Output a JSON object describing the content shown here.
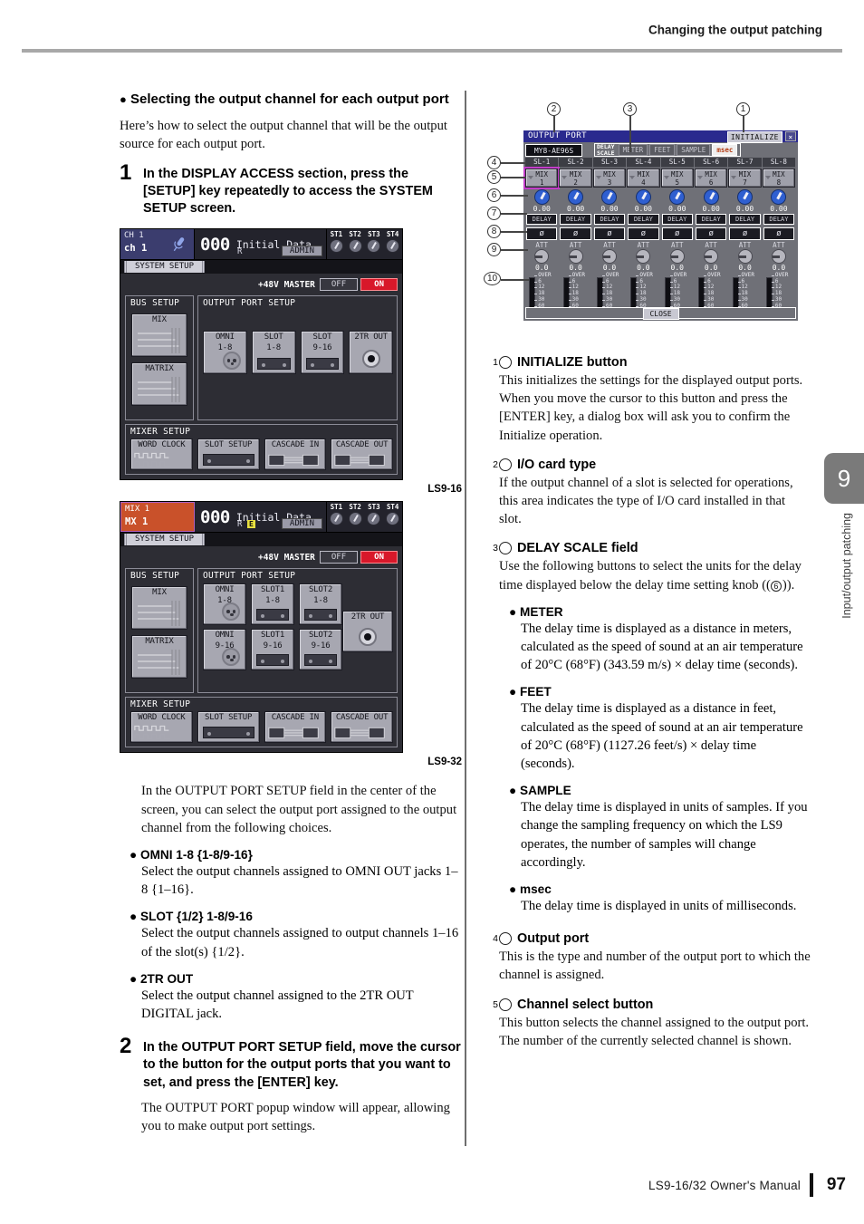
{
  "page": {
    "header_title": "Changing the output patching",
    "footer_manual": "LS9-16/32  Owner's Manual",
    "footer_page": "97",
    "side_tab_number": "9",
    "side_tab_label": "Input/output patching"
  },
  "left_column": {
    "section_heading": "Selecting the output channel for each output port",
    "intro": "Here’s how to select the output channel that will be the output source for each output port.",
    "step1": {
      "num": "1",
      "text": "In the DISPLAY ACCESS section, press the [SETUP] key repeatedly to access the SYSTEM SETUP screen."
    },
    "caption_ls9_16": "LS9-16",
    "caption_ls9_32": "LS9-32",
    "after_figures": "In the OUTPUT PORT SETUP field in the center of the screen, you can select the output port assigned to the output channel from the following choices.",
    "bullets": [
      {
        "head": "OMNI 1-8 {1-8/9-16}",
        "body": "Select the output channels assigned to OMNI OUT jacks 1–8 {1–16}."
      },
      {
        "head": "SLOT {1/2} 1-8/9-16",
        "body": "Select the output channels assigned to output channels 1–16 of the slot(s) {1/2}."
      },
      {
        "head": "2TR OUT",
        "body": "Select the output channel assigned to the 2TR OUT DIGITAL jack."
      }
    ],
    "step2": {
      "num": "2",
      "text": "In the OUTPUT PORT SETUP field, move the cursor to the button for the output ports that you want to set, and press the [ENTER] key."
    },
    "step2_body": "The OUTPUT PORT popup window will appear, allowing you to make output port settings."
  },
  "lcd_ls9_16": {
    "channel_label_top": "CH 1",
    "channel_label_bottom": "ch 1",
    "scene_number": "000",
    "scene_name": "Initial Data",
    "scene_r": "R",
    "user_level": "ADMIN",
    "st_labels": [
      "ST1",
      "ST2",
      "ST3",
      "ST4"
    ],
    "tab": "SYSTEM SETUP",
    "phantom_label": "+48V MASTER",
    "phantom_off": "OFF",
    "phantom_on": "ON",
    "bus_setup_title": "BUS SETUP",
    "bus_buttons": [
      "MIX",
      "MATRIX"
    ],
    "output_port_setup_title": "OUTPUT PORT SETUP",
    "output_buttons": [
      {
        "l1": "OMNI",
        "l2": "1-8",
        "icon": "xlr-icon"
      },
      {
        "l1": "SLOT",
        "l2": "1-8",
        "icon": "slot-icon"
      },
      {
        "l1": "SLOT",
        "l2": "9-16",
        "icon": "slot-icon"
      },
      {
        "l1": "2TR OUT",
        "l2": "",
        "icon": "coax-icon"
      }
    ],
    "mixer_setup_title": "MIXER SETUP",
    "mixer_buttons": [
      "WORD CLOCK",
      "SLOT SETUP",
      "CASCADE IN",
      "CASCADE OUT"
    ]
  },
  "lcd_ls9_32": {
    "channel_label_top": "MIX 1",
    "channel_label_bottom": "MX 1",
    "scene_number": "000",
    "scene_name": "Initial Data",
    "scene_r": "R",
    "scene_edit": "E",
    "user_level": "ADMIN",
    "st_labels": [
      "ST1",
      "ST2",
      "ST3",
      "ST4"
    ],
    "tab": "SYSTEM SETUP",
    "phantom_label": "+48V MASTER",
    "phantom_off": "OFF",
    "phantom_on": "ON",
    "bus_setup_title": "BUS SETUP",
    "bus_buttons": [
      "MIX",
      "MATRIX"
    ],
    "output_port_setup_title": "OUTPUT PORT SETUP",
    "output_row1": [
      {
        "l1": "OMNI",
        "l2": "1-8",
        "icon": "xlr-icon"
      },
      {
        "l1": "SLOT1",
        "l2": "1-8",
        "icon": "slot-icon"
      },
      {
        "l1": "SLOT2",
        "l2": "1-8",
        "icon": "slot-icon"
      }
    ],
    "output_row2": [
      {
        "l1": "OMNI",
        "l2": "9-16",
        "icon": "xlr-icon"
      },
      {
        "l1": "SLOT1",
        "l2": "9-16",
        "icon": "slot-icon"
      },
      {
        "l1": "SLOT2",
        "l2": "9-16",
        "icon": "slot-icon"
      }
    ],
    "two_tr": "2TR OUT",
    "mixer_setup_title": "MIXER SETUP",
    "mixer_buttons": [
      "WORD CLOCK",
      "SLOT SETUP",
      "CASCADE IN",
      "CASCADE OUT"
    ]
  },
  "popup": {
    "title": "OUTPUT PORT",
    "initialize_button": "INITIALIZE",
    "close_x": "×",
    "card_type": "MY8-AE96S",
    "delay_scale_label_1": "DELAY",
    "delay_scale_label_2": "SCALE",
    "delay_scale_options": [
      "METER",
      "FEET",
      "SAMPLE",
      "msec"
    ],
    "delay_scale_selected": "msec",
    "close_button": "CLOSE",
    "att_label": "ATT",
    "delay_button_label": "DELAY",
    "phase_symbol": "ø",
    "meter_scale": [
      "OVER",
      "6",
      "12",
      "18",
      "30",
      "60"
    ],
    "channels": [
      {
        "port": "SL-1",
        "ch_l1": "MIX",
        "ch_l2": "1",
        "delay": "0.00",
        "att": "0.0",
        "cursor": true
      },
      {
        "port": "SL-2",
        "ch_l1": "MIX",
        "ch_l2": "2",
        "delay": "0.00",
        "att": "0.0",
        "cursor": false
      },
      {
        "port": "SL-3",
        "ch_l1": "MIX",
        "ch_l2": "3",
        "delay": "0.00",
        "att": "0.0",
        "cursor": false
      },
      {
        "port": "SL-4",
        "ch_l1": "MIX",
        "ch_l2": "4",
        "delay": "0.00",
        "att": "0.0",
        "cursor": false
      },
      {
        "port": "SL-5",
        "ch_l1": "MIX",
        "ch_l2": "5",
        "delay": "0.00",
        "att": "0.0",
        "cursor": false
      },
      {
        "port": "SL-6",
        "ch_l1": "MIX",
        "ch_l2": "6",
        "delay": "0.00",
        "att": "0.0",
        "cursor": false
      },
      {
        "port": "SL-7",
        "ch_l1": "MIX",
        "ch_l2": "7",
        "delay": "0.00",
        "att": "0.0",
        "cursor": false
      },
      {
        "port": "SL-8",
        "ch_l1": "MIX",
        "ch_l2": "8",
        "delay": "0.00",
        "att": "0.0",
        "cursor": false
      }
    ],
    "callouts": [
      "1",
      "2",
      "3",
      "4",
      "5",
      "6",
      "7",
      "8",
      "9",
      "10"
    ]
  },
  "right_column": {
    "items": [
      {
        "num": "1",
        "head": "INITIALIZE button",
        "body": "This initializes the settings for the displayed output ports. When you move the cursor to this button and press the [ENTER] key, a dialog box will ask you to confirm the Initialize operation."
      },
      {
        "num": "2",
        "head": "I/O card type",
        "body": "If the output channel of a slot is selected for operations, this area indicates the type of I/O card installed in that slot."
      },
      {
        "num": "3",
        "head": "DELAY SCALE field",
        "body_pre": "Use the following buttons to select the units for the delay time displayed below the delay time setting knob ((",
        "body_post": ")).",
        "ref": "6"
      },
      {
        "num": "4",
        "head": "Output port",
        "body": "This is the type and number of the output port to which the channel is assigned."
      },
      {
        "num": "5",
        "head": "Channel select button",
        "body": "This button selects the channel assigned to the output port. The number of the currently selected channel is shown."
      }
    ],
    "sub_bullets": [
      {
        "head": "METER",
        "body": "The delay time is displayed as a distance in meters, calculated as the speed of sound at an air temperature of 20°C (68°F) (343.59 m/s) × delay time (seconds)."
      },
      {
        "head": "FEET",
        "body": "The delay time is displayed as a distance in feet, calculated as the speed of sound at an air temperature of 20°C (68°F) (1127.26 feet/s) × delay time (seconds)."
      },
      {
        "head": "SAMPLE",
        "body": "The delay time is displayed in units of samples. If you change the sampling frequency on which the LS9 operates, the number of samples will change accordingly."
      },
      {
        "head": "msec",
        "body": "The delay time is displayed in units of milliseconds."
      }
    ]
  }
}
